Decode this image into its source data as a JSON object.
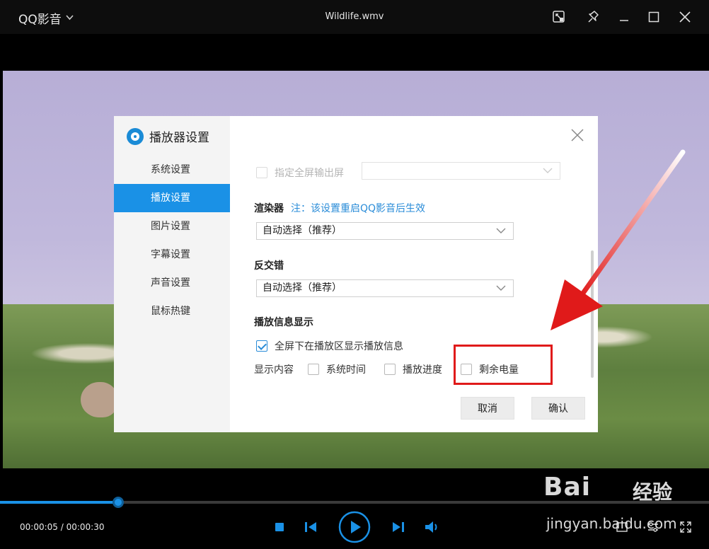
{
  "titlebar": {
    "app_name": "QQ影音",
    "file_title": "Wildlife.wmv"
  },
  "dialog": {
    "title": "播放器设置",
    "nav": [
      {
        "label": "系统设置",
        "active": false
      },
      {
        "label": "播放设置",
        "active": true
      },
      {
        "label": "图片设置",
        "active": false
      },
      {
        "label": "字幕设置",
        "active": false
      },
      {
        "label": "声音设置",
        "active": false
      },
      {
        "label": "鼠标热键",
        "active": false
      }
    ],
    "fullscreen_output": {
      "label": "指定全屏输出屏",
      "checked": false,
      "disabled": true,
      "value": ""
    },
    "renderer": {
      "title": "渲染器",
      "note": "注：该设置重启QQ影音后生效",
      "value": "自动选择（推荐）"
    },
    "deinterlace": {
      "title": "反交错",
      "value": "自动选择（推荐）"
    },
    "info_display": {
      "title": "播放信息显示",
      "show_fullscreen_info": {
        "label": "全屏下在播放区显示播放信息",
        "checked": true
      },
      "content_label": "显示内容",
      "options": [
        {
          "label": "系统时间",
          "checked": false
        },
        {
          "label": "播放进度",
          "checked": false
        },
        {
          "label": "剩余电量",
          "checked": false
        }
      ]
    },
    "buttons": {
      "cancel": "取消",
      "confirm": "确认"
    }
  },
  "player": {
    "time_text": "00:00:05 / 00:00:30",
    "progress_fraction": 0.167
  },
  "watermark": {
    "brand": "Bai",
    "brand_cn": "经验",
    "sub": "jingyan.baidu.com"
  },
  "colors": {
    "accent": "#1a91e6",
    "highlight": "#e01a1a"
  }
}
